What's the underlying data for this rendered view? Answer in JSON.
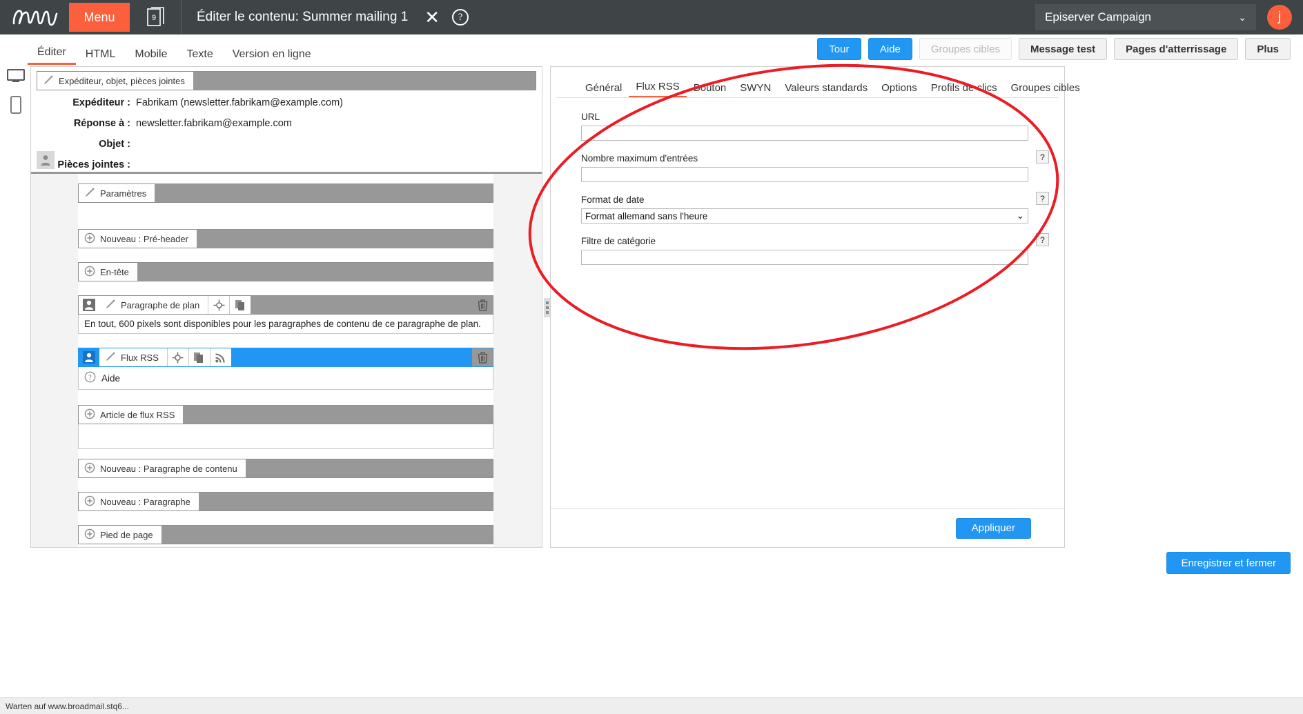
{
  "header": {
    "logo_alt": "epi-logo",
    "menu_label": "Menu",
    "stack_badge": "9",
    "doc_title": "Éditer le contenu: Summer mailing 1",
    "close_label": "✕",
    "help_label": "?",
    "app_selector": "Episerver Campaign",
    "app_selector_chevron": "⌄",
    "avatar_initial": "j"
  },
  "view_tabs": [
    {
      "label": "Éditer",
      "active": true
    },
    {
      "label": "HTML",
      "active": false
    },
    {
      "label": "Mobile",
      "active": false
    },
    {
      "label": "Texte",
      "active": false
    },
    {
      "label": "Version en ligne",
      "active": false
    }
  ],
  "toolbar_buttons": [
    {
      "label": "Tour",
      "style": "blue"
    },
    {
      "label": "Aide",
      "style": "blue"
    },
    {
      "label": "Groupes cibles",
      "style": "ghost"
    },
    {
      "label": "Message test",
      "style": "grey"
    },
    {
      "label": "Pages d'atterrissage",
      "style": "grey"
    },
    {
      "label": "Plus",
      "style": "grey"
    }
  ],
  "left_panel": {
    "header_block_label": "Expéditeur, objet, pièces jointes",
    "fields": [
      {
        "label": "Expéditeur :",
        "value": "Fabrikam (newsletter.fabrikam@example.com)"
      },
      {
        "label": "Réponse à :",
        "value": "newsletter.fabrikam@example.com"
      },
      {
        "label": "Objet :",
        "value": ""
      },
      {
        "label": "Pièces jointes :",
        "value": ""
      }
    ],
    "blocks": [
      {
        "label": "Paramètres",
        "icon": "brush-icon",
        "kind": "plain"
      },
      {
        "label": "Nouveau : Pré-header",
        "icon": "plus-circle-icon",
        "kind": "plain"
      },
      {
        "label": "En-tête",
        "icon": "plus-circle-icon",
        "kind": "plain"
      },
      {
        "label": "Paragraphe de plan",
        "icon": "brush-icon",
        "kind": "node",
        "note": "En tout, 600 pixels sont disponibles pour les paragraphes de contenu de ce paragraphe de plan."
      },
      {
        "label": "Flux RSS",
        "icon": "brush-icon",
        "kind": "selected",
        "note": "Aide"
      },
      {
        "label": "Article de flux RSS",
        "icon": "plus-circle-icon",
        "kind": "plain"
      },
      {
        "label": "Nouveau : Paragraphe de contenu",
        "icon": "plus-circle-icon",
        "kind": "plain"
      },
      {
        "label": "Nouveau : Paragraphe",
        "icon": "plus-circle-icon",
        "kind": "plain"
      },
      {
        "label": "Pied de page",
        "icon": "plus-circle-icon",
        "kind": "plain"
      }
    ]
  },
  "right_panel": {
    "tabs": [
      {
        "label": "Général",
        "active": false
      },
      {
        "label": "Flux RSS",
        "active": true
      },
      {
        "label": "Bouton",
        "active": false
      },
      {
        "label": "SWYN",
        "active": false
      },
      {
        "label": "Valeurs standards",
        "active": false
      },
      {
        "label": "Options",
        "active": false
      },
      {
        "label": "Profils de clics",
        "active": false
      },
      {
        "label": "Groupes cibles",
        "active": false
      }
    ],
    "fields": [
      {
        "label": "URL",
        "value": "",
        "type": "text",
        "help": false
      },
      {
        "label": "Nombre maximum d'entrées",
        "value": "",
        "type": "text",
        "help": true,
        "help_label": "?"
      },
      {
        "label": "Format de date",
        "value": "Format allemand sans l'heure",
        "type": "select",
        "help": true,
        "help_label": "?",
        "chevron": "⌄"
      },
      {
        "label": "Filtre de catégorie",
        "value": "",
        "type": "text",
        "help": true,
        "help_label": "?"
      }
    ],
    "apply_label": "Appliquer"
  },
  "footer": {
    "save_close_label": "Enregistrer et fermer",
    "status_text": "Warten auf www.broadmail.stq6..."
  },
  "colors": {
    "accent_orange": "#fc5f3c",
    "blue": "#2196f3",
    "dark_bar": "#3f4447",
    "block_grey": "#989898",
    "annotation_red": "#ec1c24"
  }
}
